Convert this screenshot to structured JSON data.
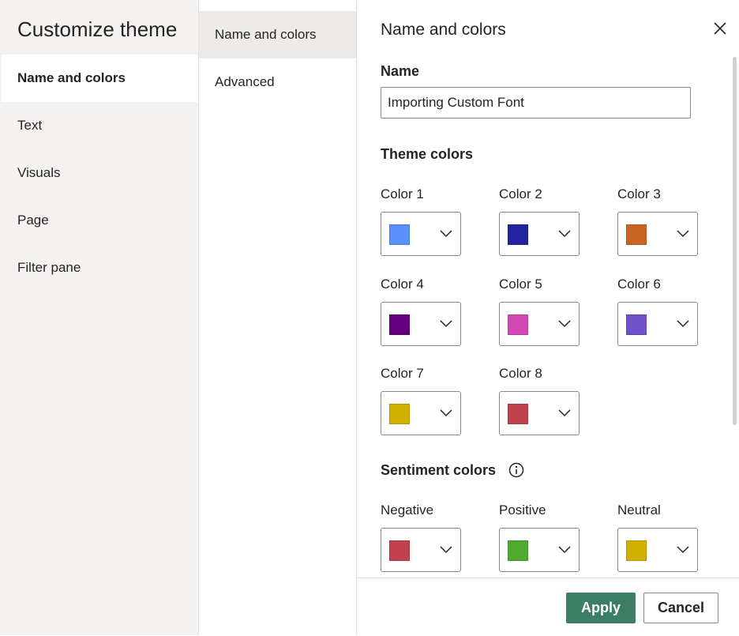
{
  "sidebar": {
    "title": "Customize theme",
    "items": [
      {
        "label": "Name and colors"
      },
      {
        "label": "Text"
      },
      {
        "label": "Visuals"
      },
      {
        "label": "Page"
      },
      {
        "label": "Filter pane"
      }
    ]
  },
  "subnav": {
    "items": [
      {
        "label": "Name and colors"
      },
      {
        "label": "Advanced"
      }
    ]
  },
  "panel": {
    "title": "Name and colors",
    "name_label": "Name",
    "name_value": "Importing Custom Font",
    "theme_colors_heading": "Theme colors",
    "theme_colors": [
      {
        "label": "Color 1",
        "color": "#5b8ff9"
      },
      {
        "label": "Color 2",
        "color": "#2323a0"
      },
      {
        "label": "Color 3",
        "color": "#cc6326"
      },
      {
        "label": "Color 4",
        "color": "#640080"
      },
      {
        "label": "Color 5",
        "color": "#d348b3"
      },
      {
        "label": "Color 6",
        "color": "#7150cc"
      },
      {
        "label": "Color 7",
        "color": "#d0b000"
      },
      {
        "label": "Color 8",
        "color": "#c2414e"
      }
    ],
    "sentiment_heading": "Sentiment colors",
    "sentiment_colors": [
      {
        "label": "Negative",
        "color": "#c2414e"
      },
      {
        "label": "Positive",
        "color": "#4faa2e"
      },
      {
        "label": "Neutral",
        "color": "#d0b000"
      }
    ]
  },
  "footer": {
    "apply_label": "Apply",
    "cancel_label": "Cancel"
  },
  "icons": {
    "close": "close-icon",
    "info": "info-icon",
    "dropdown": "chevron-down-icon"
  },
  "colors": {
    "accent": "#3b7d65",
    "sidebar_bg": "#f3f2f1",
    "subnav_selected_bg": "#edebe9"
  }
}
